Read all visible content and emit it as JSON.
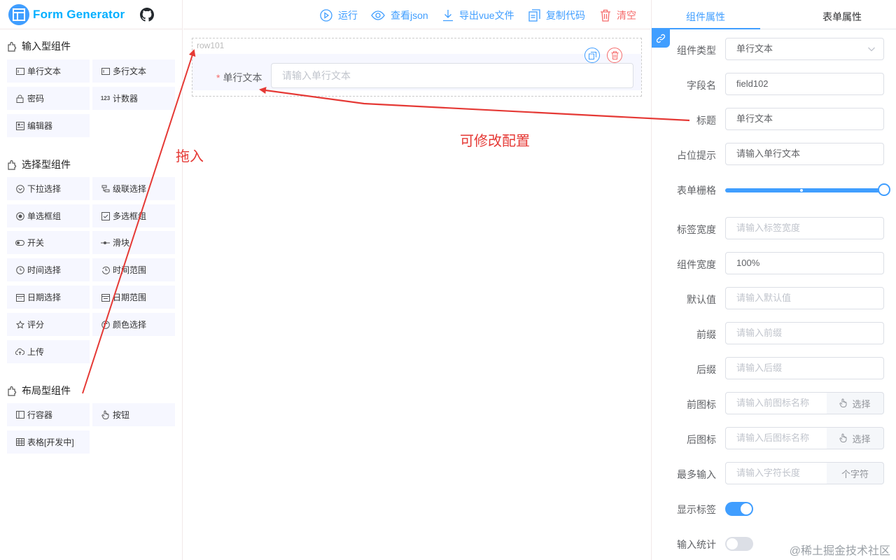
{
  "app": {
    "title": "Form Generator"
  },
  "left": {
    "groups": [
      {
        "title": "输入型组件",
        "items": [
          "单行文本",
          "多行文本",
          "密码",
          "计数器",
          "编辑器"
        ]
      },
      {
        "title": "选择型组件",
        "items": [
          "下拉选择",
          "级联选择",
          "单选框组",
          "多选框组",
          "开关",
          "滑块",
          "时间选择",
          "时间范围",
          "日期选择",
          "日期范围",
          "评分",
          "颜色选择",
          "上传"
        ]
      },
      {
        "title": "布局型组件",
        "items": [
          "行容器",
          "按钮",
          "表格[开发中]"
        ]
      }
    ],
    "icon_names": [
      "input-icon",
      "textarea-icon",
      "lock-icon",
      "number-icon",
      "editor-icon",
      "select-icon",
      "cascader-icon",
      "radio-icon",
      "checkbox-icon",
      "switch-icon",
      "slider-icon",
      "time-icon",
      "time-range-icon",
      "date-icon",
      "date-range-icon",
      "star-icon",
      "color-icon",
      "upload-icon",
      "row-icon",
      "pointer-icon",
      "table-icon"
    ]
  },
  "toolbar": {
    "run": "运行",
    "view_json": "查看json",
    "export_vue": "导出vue文件",
    "copy_code": "复制代码",
    "clear": "清空"
  },
  "canvas": {
    "row_label": "row101",
    "field_label": "单行文本",
    "required_mark": "*",
    "field_placeholder": "请输入单行文本"
  },
  "right": {
    "tabs": [
      "组件属性",
      "表单属性"
    ],
    "props": {
      "type_label": "组件类型",
      "type_value": "单行文本",
      "field_label": "字段名",
      "field_value": "field102",
      "title_label": "标题",
      "title_value": "单行文本",
      "placeholder_label": "占位提示",
      "placeholder_value": "请输入单行文本",
      "grid_label": "表单栅格",
      "grid_value": 24,
      "grid_max": 24,
      "label_width_label": "标签宽度",
      "label_width_placeholder": "请输入标签宽度",
      "width_label": "组件宽度",
      "width_value": "100%",
      "default_label": "默认值",
      "default_placeholder": "请输入默认值",
      "prefix_label": "前缀",
      "prefix_placeholder": "请输入前缀",
      "suffix_label": "后缀",
      "suffix_placeholder": "请输入后缀",
      "prefix_icon_label": "前图标",
      "prefix_icon_placeholder": "请输入前图标名称",
      "suffix_icon_label": "后图标",
      "suffix_icon_placeholder": "请输入后图标名称",
      "choose": "选择",
      "maxlength_label": "最多输入",
      "maxlength_placeholder": "请输入字符长度",
      "maxlength_unit": "个字符",
      "show_label_label": "显示标签",
      "show_label_on": true,
      "word_count_label": "输入统计",
      "word_count_on": false
    }
  },
  "annotations": {
    "drag_in": "拖入",
    "editable_config": "可修改配置"
  },
  "watermark": "@稀土掘金技术社区",
  "colors": {
    "primary": "#409eff",
    "danger": "#f56c6c",
    "annotation": "#e53935"
  }
}
